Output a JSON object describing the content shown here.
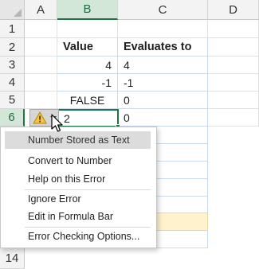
{
  "columns": [
    "A",
    "B",
    "C",
    "D"
  ],
  "rows": [
    "1",
    "2",
    "3",
    "4",
    "5",
    "6",
    "14"
  ],
  "table": {
    "headers": [
      "Value",
      "Evaluates to"
    ],
    "rows": [
      [
        "4",
        "4"
      ],
      [
        "-1",
        "-1"
      ],
      [
        "FALSE",
        "0"
      ],
      [
        "2",
        "0"
      ]
    ]
  },
  "active_cell": "B6",
  "colors": {
    "selection": "#217346",
    "table_border": "#c9d9ee",
    "highlight_cell": "#fff2cc"
  },
  "smart_tag": {
    "icon": "warning-icon"
  },
  "menu": {
    "header": "Number Stored as Text",
    "items": [
      "Convert to Number",
      "Help on this Error",
      "Ignore Error",
      "Edit in Formula Bar",
      "Error Checking Options..."
    ]
  }
}
